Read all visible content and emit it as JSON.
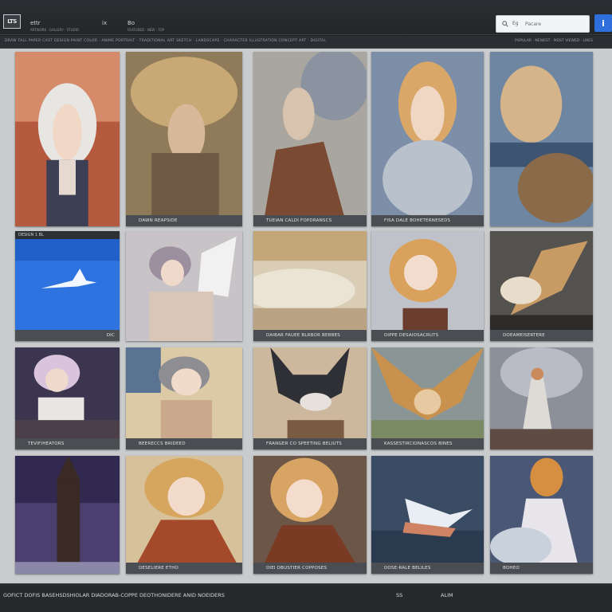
{
  "header": {
    "logo_text": "LTS",
    "app_name": "ettr",
    "app_sub": "ARTWORK · GALLERY · STUDIO",
    "nav": [
      {
        "label": "ix",
        "sub": ""
      },
      {
        "label": "Bo",
        "sub": "FEATURED · NEW · TOP"
      }
    ],
    "search": {
      "scope": "Eg",
      "placeholder": "Pacare"
    },
    "info_label": "i"
  },
  "subbar": {
    "filters": "DRAW FALL PAPER CAST DESIGN PAINT COLOR · ANIME PORTRAIT · TRADITIONAL ART SKETCH · LANDSCAPE · CHARACTER ILLUSTRATION CONCEPT ART · DIGITAL",
    "sort": "POPULAR · NEWEST · MOST VIEWED · LIKES"
  },
  "gallery": {
    "items": [
      {
        "caption": "",
        "scene": "portrait-silver"
      },
      {
        "caption": "DAWN REAPSIDE",
        "scene": "warrior-gold"
      },
      {
        "caption": "TUEIAN CALDI FOPDRANSCS",
        "scene": "knight-sketch"
      },
      {
        "caption": "FISA DALE BOHETERNESEDS",
        "scene": "blonde-feathers"
      },
      {
        "caption": "",
        "scene": "sleeping-rider"
      },
      {
        "caption": "DIC",
        "scene": "blue-sky",
        "header": "DESIGN 1 BL"
      },
      {
        "caption": "",
        "scene": "angel-sketch"
      },
      {
        "caption": "DAIBAR FAUEE BLRBOR BEBBES",
        "scene": "sand-clouds"
      },
      {
        "caption": "DIPPE DESAIOSACRUTS",
        "scene": "blonde-long"
      },
      {
        "caption": "DOEAMEISERTERE",
        "scene": "golden-wings"
      },
      {
        "caption": "TEVIFIHEATORS",
        "scene": "lace-lady"
      },
      {
        "caption": "BEERECCS BRIDEED",
        "scene": "silver-portrait"
      },
      {
        "caption": "FRANGER CO SPEETING BELIUTS",
        "scene": "black-fox"
      },
      {
        "caption": "KASSESTIRCIONASCOS BINES",
        "scene": "winged-fox"
      },
      {
        "caption": "",
        "scene": "dancer"
      },
      {
        "caption": "",
        "scene": "tower-night"
      },
      {
        "caption": "DESELIERE ETHO",
        "scene": "red-cloak"
      },
      {
        "caption": "DIEI DBUSTIER COPPOSES",
        "scene": "blonde-brown"
      },
      {
        "caption": "DOSE-RALE BELILES",
        "scene": "white-bird"
      },
      {
        "caption": "BOHEO",
        "scene": "cloud-figure"
      }
    ]
  },
  "footer": {
    "text": "GOFICT DOFIS BASEHSDSHIOLAR DIADORAB-COPPE DEOTHONIDERE ANID NOEIDERS",
    "page_current": "SS",
    "page_total": "ALIM"
  },
  "colors": {
    "accent": "#2e6fdc",
    "panel": "#c9cbcd",
    "chrome": "#24272a",
    "caption_bar": "#4a4d51"
  }
}
